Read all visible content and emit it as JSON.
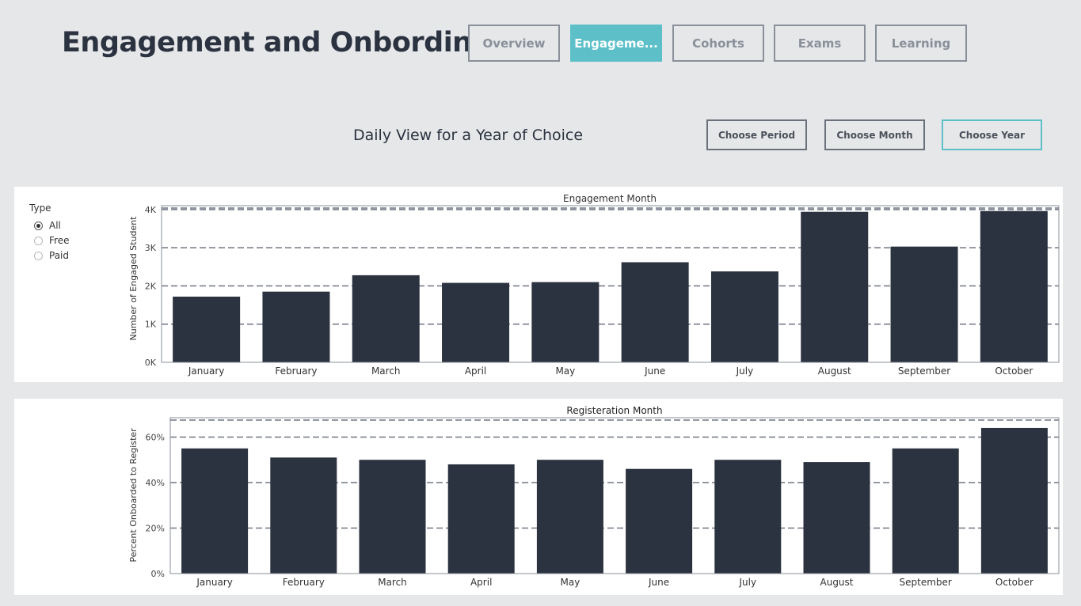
{
  "header": {
    "title": "Engagement and Onbording",
    "tabs": [
      {
        "label": "Overview",
        "active": false
      },
      {
        "label": "Engageme...",
        "active": true
      },
      {
        "label": "Cohorts",
        "active": false
      },
      {
        "label": "Exams",
        "active": false
      },
      {
        "label": "Learning",
        "active": false
      }
    ]
  },
  "view": {
    "subtitle": "Daily View for a Year of Choice",
    "controls": [
      {
        "label": "Choose Period",
        "active": false
      },
      {
        "label": "Choose Month",
        "active": false
      },
      {
        "label": "Choose Year",
        "active": true
      }
    ]
  },
  "filter": {
    "title": "Type",
    "options": [
      {
        "label": "All",
        "checked": true
      },
      {
        "label": "Free",
        "checked": false
      },
      {
        "label": "Paid",
        "checked": false
      }
    ]
  },
  "colors": {
    "accent": "#5dc0c9",
    "bar": "#2b3240",
    "background": "#e6e7e9"
  },
  "chart_data": [
    {
      "type": "bar",
      "title": "Engagement Month",
      "xlabel": "",
      "ylabel": "Number of Engaged Student",
      "categories": [
        "January",
        "February",
        "March",
        "April",
        "May",
        "June",
        "July",
        "August",
        "September",
        "October"
      ],
      "values": [
        1720,
        1850,
        2280,
        2080,
        2100,
        2620,
        2380,
        3940,
        3030,
        3960
      ],
      "ylim": [
        0,
        4100
      ],
      "yticks": [
        0,
        1000,
        2000,
        3000,
        4000
      ],
      "ytick_labels": [
        "0K",
        "1K",
        "2K",
        "3K",
        "4K"
      ],
      "grid": "dashed horizontal"
    },
    {
      "type": "bar",
      "title": "Registeration Month",
      "xlabel": "",
      "ylabel": "Percent Onboarded to Register",
      "categories": [
        "January",
        "February",
        "March",
        "April",
        "May",
        "June",
        "July",
        "August",
        "September",
        "October"
      ],
      "values": [
        55,
        51,
        50,
        48,
        50,
        46,
        50,
        49,
        55,
        64
      ],
      "ylim": [
        0,
        68.5
      ],
      "yticks": [
        0,
        20,
        40,
        60
      ],
      "ytick_labels": [
        "0%",
        "20%",
        "40%",
        "60%"
      ],
      "grid": "dashed horizontal"
    }
  ]
}
